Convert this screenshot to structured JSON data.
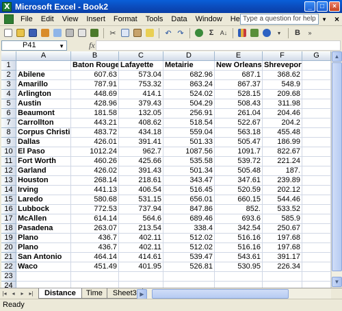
{
  "window": {
    "title": "Microsoft Excel - Book2"
  },
  "menu": {
    "items": [
      "File",
      "Edit",
      "View",
      "Insert",
      "Format",
      "Tools",
      "Data",
      "Window",
      "Help"
    ],
    "help_placeholder": "Type a question for help"
  },
  "toolbar": {
    "icons": [
      "new-icon",
      "open-icon",
      "save-icon",
      "permission-icon",
      "email-icon",
      "print-icon",
      "print-preview-icon",
      "spelling-icon",
      "cut-icon",
      "copy-icon",
      "paste-icon",
      "format-painter-icon",
      "undo-icon",
      "redo-icon",
      "hyperlink-icon",
      "autosum-icon",
      "sort-ascending-icon",
      "chart-wizard-icon",
      "help-icon"
    ],
    "sigma": "Σ",
    "zoom_symbol": "▾"
  },
  "formula_bar": {
    "name_box": "P41",
    "fx_label": "fx",
    "formula": ""
  },
  "grid": {
    "columns": [
      "A",
      "B",
      "C",
      "D",
      "E",
      "F",
      "G"
    ],
    "row_numbers": [
      "1",
      "2",
      "3",
      "4",
      "5",
      "6",
      "7",
      "8",
      "9",
      "10",
      "11",
      "12",
      "13",
      "14",
      "15",
      "16",
      "17",
      "18",
      "19",
      "20",
      "21",
      "22",
      "23",
      "24"
    ],
    "header_row": [
      "",
      "Baton Rouge",
      "Lafayette",
      "Metairie",
      "New Orleans",
      "Shreveport",
      ""
    ],
    "rows": [
      [
        "Abilene",
        "607.63",
        "573.04",
        "682.96",
        "687.1",
        "368.62"
      ],
      [
        "Amarillo",
        "787.91",
        "753.32",
        "863.24",
        "867.37",
        "548.9"
      ],
      [
        "Arlington",
        "448.69",
        "414.1",
        "524.02",
        "528.15",
        "209.68"
      ],
      [
        "Austin",
        "428.96",
        "379.43",
        "504.29",
        "508.43",
        "311.98"
      ],
      [
        "Beaumont",
        "181.58",
        "132.05",
        "256.91",
        "261.04",
        "204.46"
      ],
      [
        "Carrollton",
        "443.21",
        "408.62",
        "518.54",
        "522.67",
        "204.2"
      ],
      [
        "Corpus Christi",
        "483.72",
        "434.18",
        "559.04",
        "563.18",
        "455.48"
      ],
      [
        "Dallas",
        "426.01",
        "391.41",
        "501.33",
        "505.47",
        "186.99"
      ],
      [
        "El Paso",
        "1012.24",
        "962.7",
        "1087.56",
        "1091.7",
        "822.67"
      ],
      [
        "Fort Worth",
        "460.26",
        "425.66",
        "535.58",
        "539.72",
        "221.24"
      ],
      [
        "Garland",
        "426.02",
        "391.43",
        "501.34",
        "505.48",
        "187."
      ],
      [
        "Houston",
        "268.14",
        "218.61",
        "343.47",
        "347.61",
        "239.89"
      ],
      [
        "Irving",
        "441.13",
        "406.54",
        "516.45",
        "520.59",
        "202.12"
      ],
      [
        "Laredo",
        "580.68",
        "531.15",
        "656.01",
        "660.15",
        "544.46"
      ],
      [
        "Lubbock",
        "772.53",
        "737.94",
        "847.86",
        "852.",
        "533.52"
      ],
      [
        "McAllen",
        "614.14",
        "564.6",
        "689.46",
        "693.6",
        "585.9"
      ],
      [
        "Pasadena",
        "263.07",
        "213.54",
        "338.4",
        "342.54",
        "250.67"
      ],
      [
        "Plano",
        "436.7",
        "402.11",
        "512.02",
        "516.16",
        "197.68"
      ],
      [
        "Plano",
        "436.7",
        "402.11",
        "512.02",
        "516.16",
        "197.68"
      ],
      [
        "San Antonio",
        "464.14",
        "414.61",
        "539.47",
        "543.61",
        "391.17"
      ],
      [
        "Waco",
        "451.49",
        "401.95",
        "526.81",
        "530.95",
        "226.34"
      ]
    ]
  },
  "sheets": {
    "tabs": [
      "Distance",
      "Time",
      "Sheet3"
    ],
    "active": "Distance"
  },
  "status": {
    "text": "Ready"
  }
}
